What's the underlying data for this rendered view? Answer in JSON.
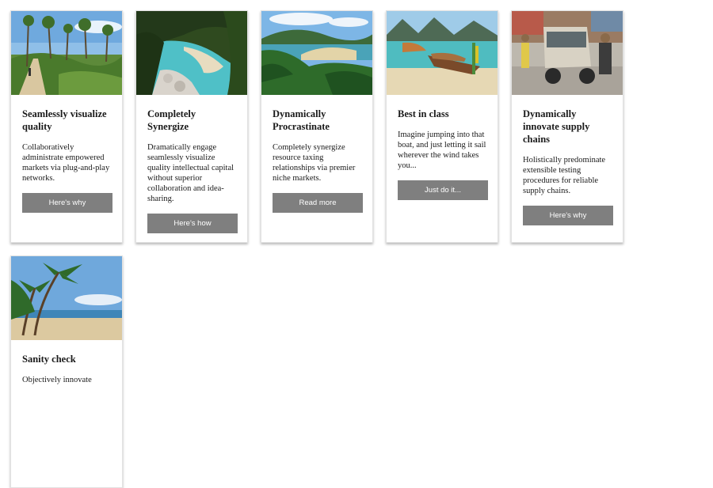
{
  "cards": [
    {
      "image": "beach-path-palms-photo",
      "title": "Seamlessly visualize quality",
      "text": "Collaboratively administrate empowered markets via plug-and-play networks.",
      "button": "Here's why"
    },
    {
      "image": "turquoise-cove-photo",
      "title": "Completely Synergize",
      "text": "Dramatically engage seamlessly visualize quality intellectual capital without superior collaboration and idea-sharing.",
      "button": "Here's how"
    },
    {
      "image": "jungle-beach-bay-photo",
      "title": "Dynamically Procrastinate",
      "text": "Completely synergize resource taxing relationships via premier niche markets.",
      "button": "Read more"
    },
    {
      "image": "longtail-boat-photo",
      "title": "Best in class",
      "text": "Imagine jumping into that boat, and just letting it sail wherever the wind takes you...",
      "button": "Just do it..."
    },
    {
      "image": "tuk-tuk-street-photo",
      "title": "Dynamically innovate supply chains",
      "text": "Holistically predominate extensible testing procedures for reliable supply chains.",
      "button": "Here's why"
    },
    {
      "image": "palm-beach-photo",
      "title": "Sanity check",
      "text": "Objectively innovate",
      "button": ""
    }
  ]
}
